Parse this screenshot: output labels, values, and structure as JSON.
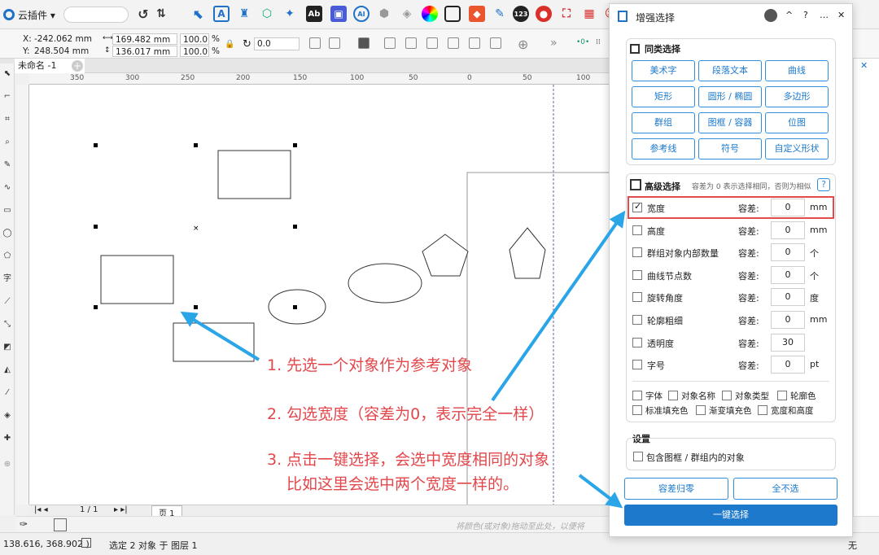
{
  "toolbar": {
    "app_name": "云插件 ▾",
    "icons": [
      "undo-icon",
      "sort-icon",
      "select-icon",
      "text-icon",
      "fill-icon",
      "shape-icon",
      "dragon-icon",
      "abc-icon",
      "image-icon",
      "ai-icon",
      "cube-icon",
      "color-wheel-icon",
      "square-icon",
      "stamp-icon",
      "magic-icon",
      "123-icon",
      "record-icon",
      "screen-icon",
      "image-edit-icon",
      "user-icon",
      "star-icon",
      "gear-icon"
    ]
  },
  "propbar": {
    "x_label": "X:",
    "x_value": "-242.062 mm",
    "y_label": "Y:",
    "y_value": "248.504 mm",
    "w_value": "169.482 mm",
    "h_value": "136.017 mm",
    "sx_value": "100.0",
    "sy_value": "100.0",
    "pct": "%",
    "angle_value": "0.0"
  },
  "doc": {
    "tab_name": "未命名 -1",
    "new_tab": "+"
  },
  "ruler": [
    "350",
    "300",
    "250",
    "200",
    "150",
    "100",
    "50",
    "0",
    "50",
    "100"
  ],
  "pagebar": {
    "page_count": "1 / 1",
    "page_tab": "页 1"
  },
  "statusbar": {
    "coords": "138.616, 368.902 )",
    "selection_info": "选定 2 对象 于 图层 1",
    "fill_text": "无",
    "hint": "将颜色(或对象)拖动至此处，以便将"
  },
  "panel": {
    "title": "增强选择",
    "header_buttons": [
      "^",
      "?",
      "…",
      "✕"
    ],
    "same_type_title": "同类选择",
    "same_type_buttons": [
      "美术字",
      "段落文本",
      "曲线",
      "矩形",
      "圆形 / 椭圆",
      "多边形",
      "群组",
      "图框 / 容器",
      "位图",
      "参考线",
      "符号",
      "自定义形状"
    ],
    "advanced_title": "高级选择",
    "advanced_hint": "容差为 0 表示选择相同，否则为相似",
    "help": "?",
    "tol_label": "容差:",
    "rows": [
      {
        "label": "宽度",
        "checked": true,
        "value": "0",
        "unit": "mm"
      },
      {
        "label": "高度",
        "checked": false,
        "value": "0",
        "unit": "mm"
      },
      {
        "label": "群组对象内部数量",
        "checked": false,
        "value": "0",
        "unit": "个"
      },
      {
        "label": "曲线节点数",
        "checked": false,
        "value": "0",
        "unit": "个"
      },
      {
        "label": "旋转角度",
        "checked": false,
        "value": "0",
        "unit": "度"
      },
      {
        "label": "轮廓粗细",
        "checked": false,
        "value": "0",
        "unit": "mm"
      },
      {
        "label": "透明度",
        "checked": false,
        "value": "30",
        "unit": ""
      },
      {
        "label": "字号",
        "checked": false,
        "value": "0",
        "unit": "pt"
      }
    ],
    "extra_checks": [
      "字体",
      "对象名称",
      "对象类型",
      "轮廓色",
      "标准填充色",
      "渐变填充色",
      "宽度和高度"
    ],
    "settings_title": "设置",
    "settings_check": "包含图框 / 群组内的对象",
    "btn_reset": "容差归零",
    "btn_none": "全不选",
    "btn_select": "一键选择"
  },
  "annotations": {
    "step1": "1. 先选一个对象作为参考对象",
    "step2": "2. 勾选宽度（容差为0，表示完全一样）",
    "step3_line1": "3. 点击一键选择，会选中宽度相同的对象",
    "step3_line2": "比如这里会选中两个宽度一样的。"
  },
  "colors": {
    "accent": "#1c79cc",
    "annotation": "#e2474b",
    "arrow": "#2aa6e8",
    "highlight": "#e24b4b"
  }
}
